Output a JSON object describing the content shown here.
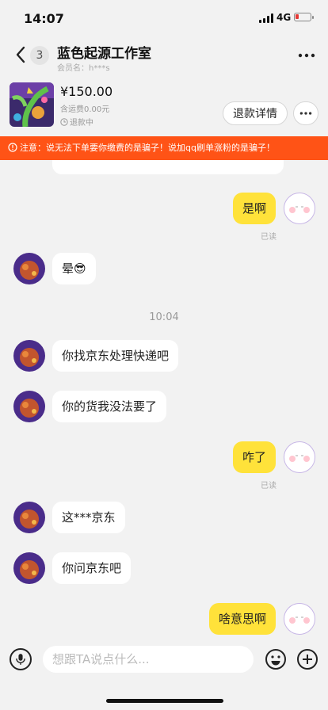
{
  "status_bar": {
    "time": "14:07",
    "network": "4G"
  },
  "header": {
    "unread_count": "3",
    "shop_name": "蓝色起源工作室",
    "member_label": "会员名：h***s"
  },
  "order": {
    "price": "¥150.00",
    "shipping": "含运费0.00元",
    "status": "退款中",
    "refund_button": "退款详情"
  },
  "warning": {
    "text": "注意：说无法下单要你缴费的是骗子！说加qq刷单涨粉的是骗子！"
  },
  "messages": [
    {
      "from": "me",
      "text": "是啊",
      "read": "已读"
    },
    {
      "from": "them",
      "text": "晕😎"
    },
    {
      "from": "time",
      "text": "10:04"
    },
    {
      "from": "them",
      "text": "你找京东处理快递吧"
    },
    {
      "from": "them",
      "text": "你的货我没法要了"
    },
    {
      "from": "me",
      "text": "咋了",
      "read": "已读"
    },
    {
      "from": "them",
      "text": "这***京东"
    },
    {
      "from": "them",
      "text": "你问京东吧"
    },
    {
      "from": "me",
      "text": "啥意思啊"
    }
  ],
  "input": {
    "placeholder": "想跟TA说点什么..."
  },
  "icons": {
    "back": "chevron-left-icon",
    "menu": "more-horizontal-icon",
    "clock": "clock-icon",
    "warning": "info-circle-icon",
    "mic": "microphone-icon",
    "emoji": "emoji-icon",
    "plus": "plus-circle-icon"
  },
  "colors": {
    "warning_bg": "#ff5316",
    "my_bubble": "#ffe23a",
    "their_bubble": "#ffffff",
    "background": "#f2f2f2"
  }
}
